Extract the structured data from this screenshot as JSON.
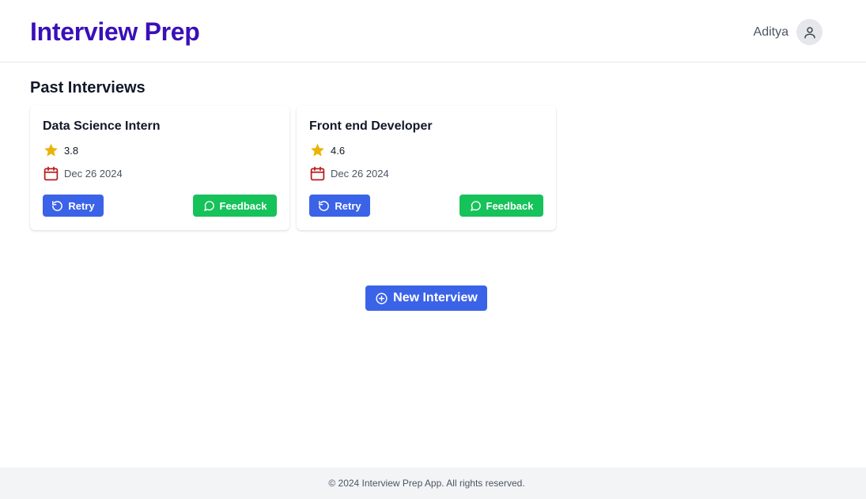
{
  "header": {
    "brand": "Interview Prep",
    "user_name": "Aditya"
  },
  "main": {
    "section_title": "Past Interviews",
    "cards": [
      {
        "title": "Data Science Intern",
        "rating": "3.8",
        "date": "Dec 26 2024",
        "retry_label": "Retry",
        "feedback_label": "Feedback"
      },
      {
        "title": "Front end Developer",
        "rating": "4.6",
        "date": "Dec 26 2024",
        "retry_label": "Retry",
        "feedback_label": "Feedback"
      }
    ],
    "new_interview_label": "New Interview"
  },
  "footer": {
    "text": "© 2024 Interview Prep App. All rights reserved."
  },
  "colors": {
    "brand": "#3b0fb8",
    "primary_button": "#3b63e8",
    "feedback_button": "#16c25a",
    "star": "#eab308",
    "calendar": "#b91c1c"
  },
  "icons": {
    "user": "user-icon",
    "star": "star-icon",
    "calendar": "calendar-icon",
    "retry": "retry-icon",
    "feedback": "chat-bubble-icon",
    "new": "plus-circle-icon"
  }
}
